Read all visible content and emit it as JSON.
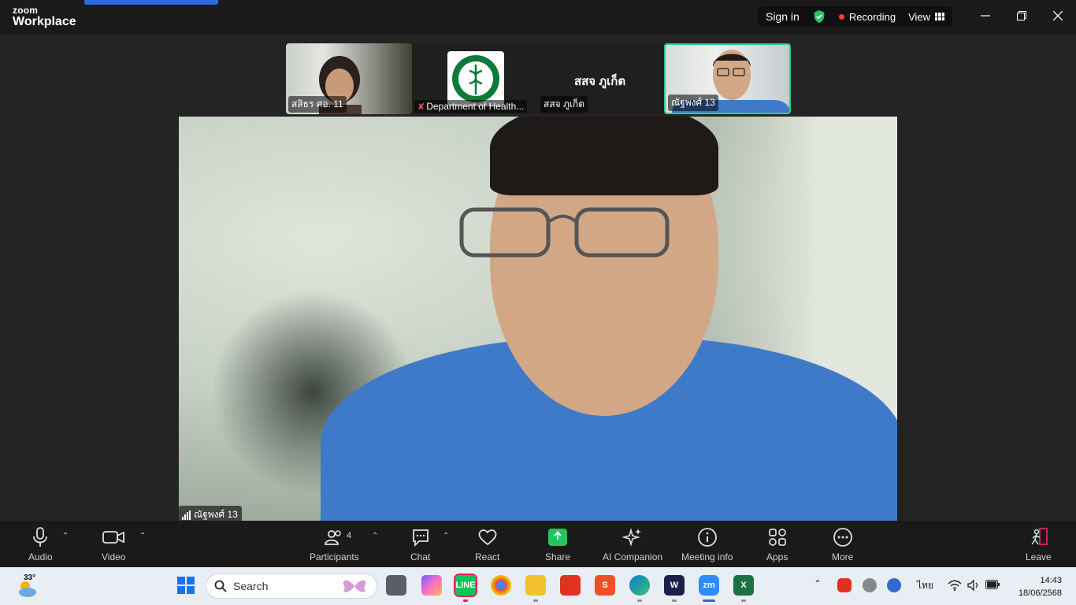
{
  "app": {
    "brand_top": "zoom",
    "brand_bottom": "Workplace"
  },
  "status": {
    "sign_in": "Sign in",
    "recording": "Recording",
    "view": "View"
  },
  "gallery": [
    {
      "name": "สสิธร ศอ. 11"
    },
    {
      "name": "Department of Health..."
    },
    {
      "name": "สสจ ภูเก็ต",
      "display_name": "สสจ ภูเก็ต"
    },
    {
      "name": "ณัฐพงศ์ 13",
      "active_speaker": true
    }
  ],
  "main_video": {
    "name": "ณัฐพงศ์ 13"
  },
  "toolbar": {
    "audio": "Audio",
    "video": "Video",
    "participants": "Participants",
    "participants_count": "4",
    "chat": "Chat",
    "react": "React",
    "share": "Share",
    "ai_companion": "AI Companion",
    "meeting_info": "Meeting info",
    "apps": "Apps",
    "more": "More",
    "leave": "Leave"
  },
  "taskbar": {
    "weather_temp": "33°",
    "search_placeholder": "Search",
    "language": "ไทย",
    "time": "14:43",
    "date": "18/06/2568"
  },
  "colors": {
    "accent_green": "#23d18b",
    "share_green": "#23c55e",
    "recording_red": "#ff3b30",
    "leave_red": "#e0245e"
  }
}
